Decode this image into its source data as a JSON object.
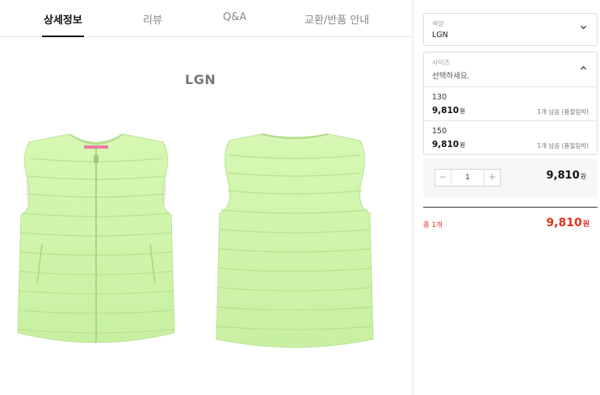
{
  "tabs": [
    {
      "label": "상세정보",
      "active": true
    },
    {
      "label": "리뷰",
      "active": false
    },
    {
      "label": "Q&A",
      "active": false
    },
    {
      "label": "교환/반품 안내",
      "active": false
    }
  ],
  "product": {
    "color_caption": "LGN",
    "vest_color": "#cdf5a8",
    "vest_shade": "#b5e48d",
    "lining_color": "#ece6dc"
  },
  "options": {
    "color": {
      "label": "색상",
      "value": "LGN",
      "icon": "chevron-down-icon"
    },
    "size": {
      "label": "사이즈",
      "placeholder": "선택하세요.",
      "icon": "chevron-up-icon",
      "items": [
        {
          "size": "130",
          "price": "9,810",
          "unit": "원",
          "stock": "1개 남음 (품절임박)"
        },
        {
          "size": "150",
          "price": "9,810",
          "unit": "원",
          "stock": "1개 남음 (품절임박)"
        }
      ]
    }
  },
  "quantity": {
    "value": "1",
    "minus": "−",
    "plus": "+",
    "price": "9,810",
    "unit": "원"
  },
  "total": {
    "label": "총 1개",
    "price": "9,810",
    "unit": "원",
    "color": "#e0321e"
  }
}
